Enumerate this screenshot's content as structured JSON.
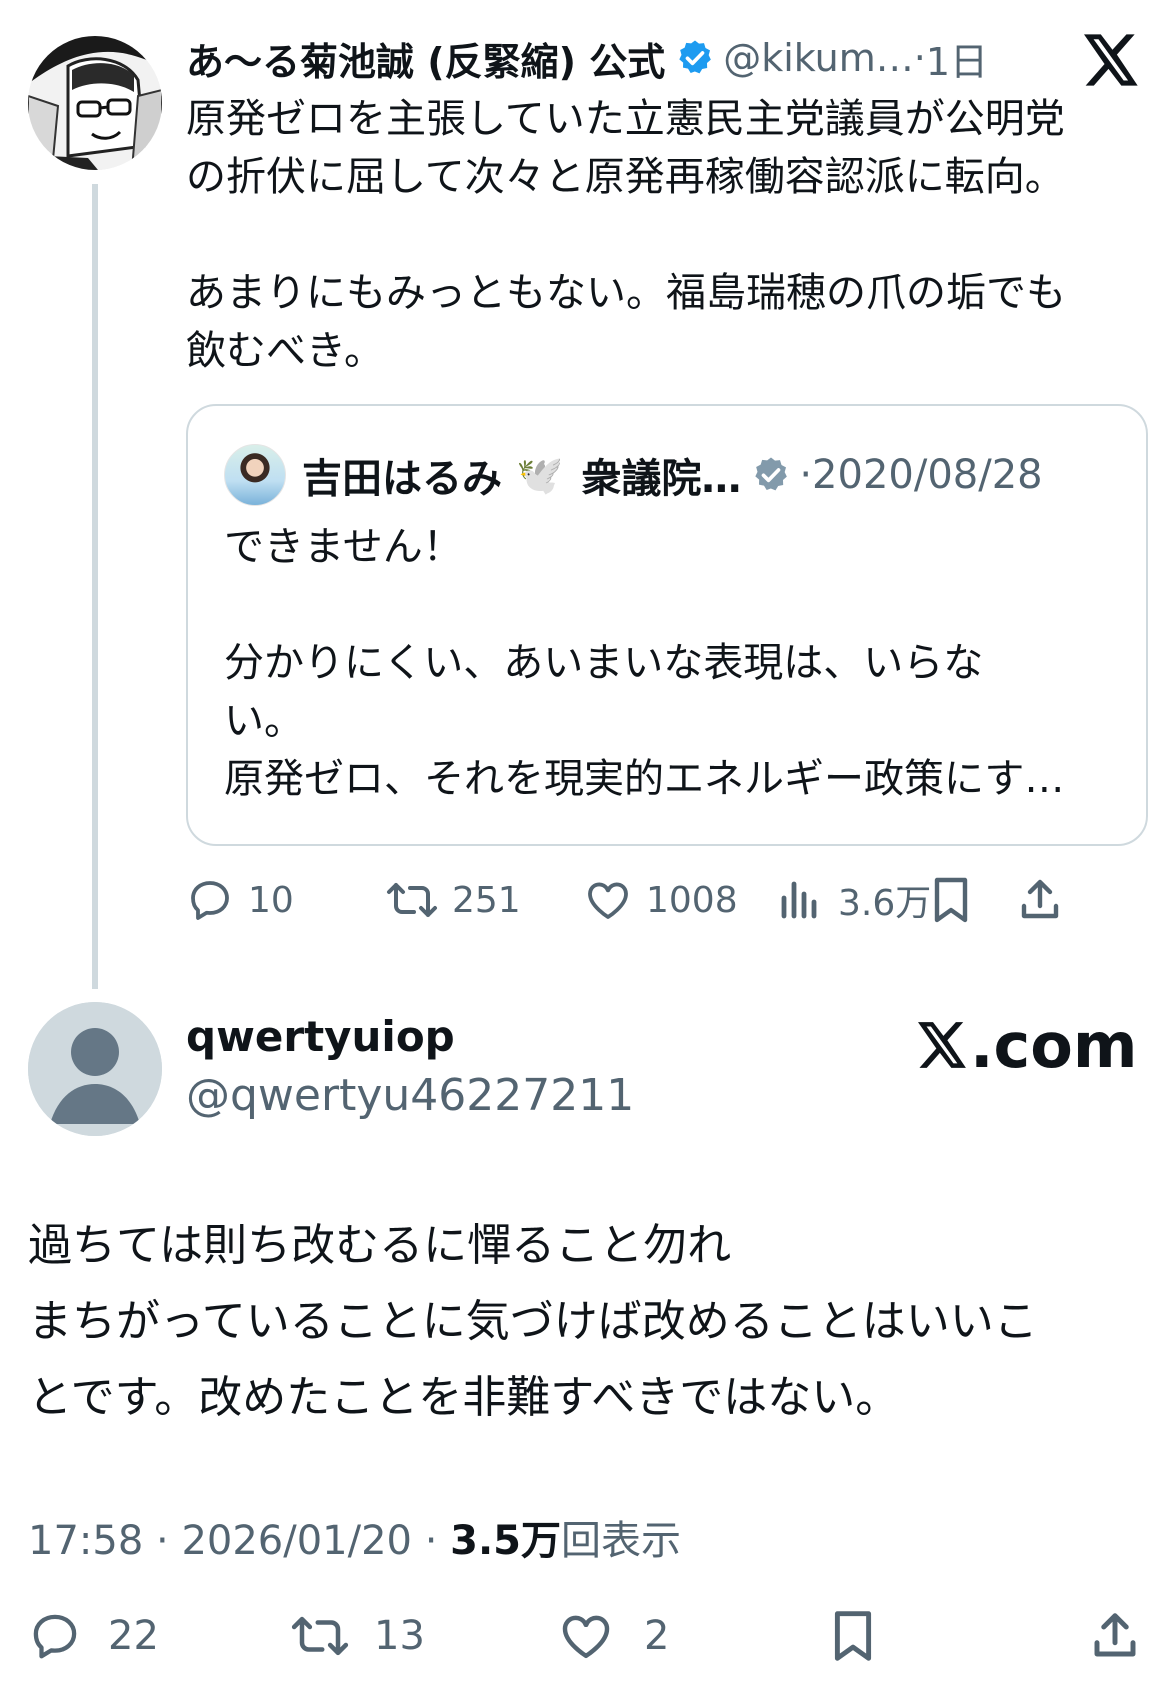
{
  "parent": {
    "display_name": "あ〜る菊池誠 (反緊縮) 公式",
    "handle": "@kikum…",
    "time": "1日",
    "text": "原発ゼロを主張していた立憲民主党議員が公明党\nの折伏に屈して次々と原発再稼働容認派に転向。\n\nあまりにもみっともない。福島瑞穂の爪の垢でも\n飲むべき。",
    "quote": {
      "display_name": "吉田はるみ",
      "badge": "🕊️",
      "title": "衆議院…",
      "date": "2020/08/28",
      "text": "できません！\n\n分かりにくい、あいまいな表現は、いらな\nい。\n原発ゼロ、それを現実的エネルギー政策にす…"
    },
    "stats": {
      "replies": "10",
      "reposts": "251",
      "likes": "1008",
      "views": "3.6万"
    }
  },
  "reply": {
    "display_name": "qwertyuiop",
    "handle": "@qwertyu46227211",
    "text": "過ちては則ち改むるに憚ること勿れ\nまちがっていることに気づけば改めることはいいこ\nとです。改めたことを非難すべきではない。",
    "time": "17:58",
    "date": "2026/01/20",
    "views_count": "3.5万",
    "views_label": "回表示",
    "stats": {
      "replies": "22",
      "reposts": "13",
      "likes": "2"
    }
  },
  "watermark": "X.com",
  "colors": {
    "text": "#0f1419",
    "muted": "#536471",
    "border": "#cfd9de",
    "verified": "#1d9bf0"
  }
}
